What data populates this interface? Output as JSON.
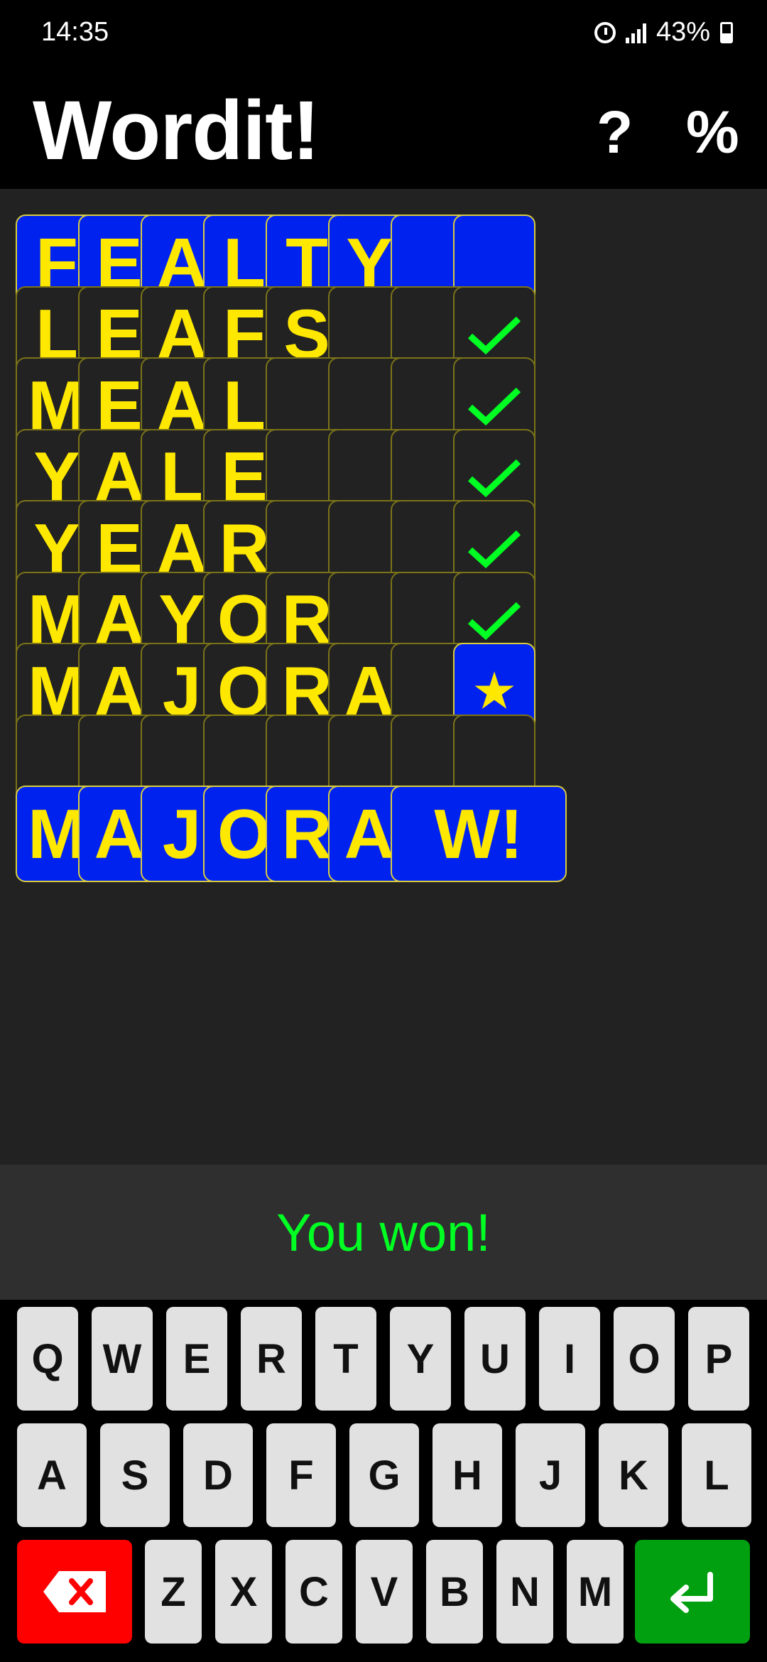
{
  "status": {
    "time": "14:35",
    "battery": "43%"
  },
  "app": {
    "title": "Wordit!",
    "help_label": "?",
    "stats_label": "%"
  },
  "board": {
    "rows": [
      {
        "letters": [
          "F",
          "E",
          "A",
          "L",
          "T",
          "Y",
          "",
          ""
        ],
        "style": "blue",
        "marker": ""
      },
      {
        "letters": [
          "L",
          "E",
          "A",
          "F",
          "S",
          "",
          ""
        ],
        "style": "normal",
        "marker": "check"
      },
      {
        "letters": [
          "M",
          "E",
          "A",
          "L",
          "",
          "",
          ""
        ],
        "style": "normal",
        "marker": "check"
      },
      {
        "letters": [
          "Y",
          "A",
          "L",
          "E",
          "",
          "",
          ""
        ],
        "style": "normal",
        "marker": "check"
      },
      {
        "letters": [
          "Y",
          "E",
          "A",
          "R",
          "",
          "",
          ""
        ],
        "style": "normal",
        "marker": "check"
      },
      {
        "letters": [
          "M",
          "A",
          "Y",
          "O",
          "R",
          "",
          ""
        ],
        "style": "normal",
        "marker": "check"
      },
      {
        "letters": [
          "M",
          "A",
          "J",
          "O",
          "R",
          "A",
          ""
        ],
        "style": "normal",
        "marker": "star"
      },
      {
        "letters": [
          "",
          "",
          "",
          "",
          "",
          "",
          ""
        ],
        "style": "normal",
        "marker": ""
      }
    ],
    "answer": {
      "letters": [
        "M",
        "A",
        "J",
        "O",
        "R",
        "A"
      ],
      "result": "W!"
    }
  },
  "message": "You won!",
  "keyboard": {
    "row1": [
      "Q",
      "W",
      "E",
      "R",
      "T",
      "Y",
      "U",
      "I",
      "O",
      "P"
    ],
    "row2": [
      "A",
      "S",
      "D",
      "F",
      "G",
      "H",
      "J",
      "K",
      "L"
    ],
    "row3": [
      "Z",
      "X",
      "C",
      "V",
      "B",
      "N",
      "M"
    ],
    "delete_icon": "backspace-icon",
    "enter_icon": "enter-icon"
  },
  "colors": {
    "tile_blue": "#0022ee",
    "letter_yellow": "#ffe800",
    "check_green": "#00ff22",
    "delete_red": "#ff0000",
    "enter_green": "#00a010"
  }
}
